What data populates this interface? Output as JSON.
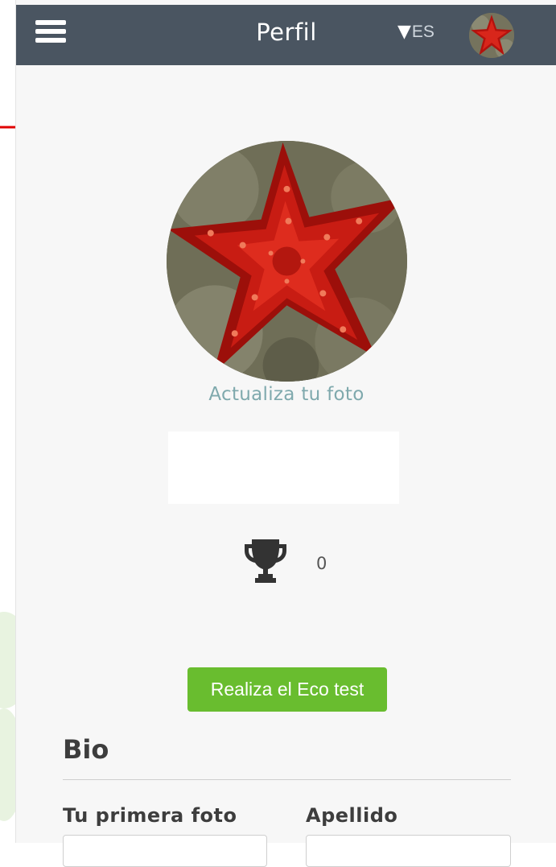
{
  "header": {
    "title": "Perfil",
    "language_arrow": "▼",
    "language_code": "ES"
  },
  "profile": {
    "update_photo_label": "Actualiza tu foto",
    "trophy_count": "0",
    "eco_test_button": "Realiza el Eco test"
  },
  "bio": {
    "section_title": "Bio",
    "first_field_label": "Tu primera foto",
    "last_name_label": "Apellido",
    "first_field_value": "",
    "last_name_value": ""
  },
  "colors": {
    "topbar": "#4a5561",
    "accent_green": "#69bd2f",
    "link_teal": "#7fa9ad",
    "annotation_red": "#e00000"
  }
}
